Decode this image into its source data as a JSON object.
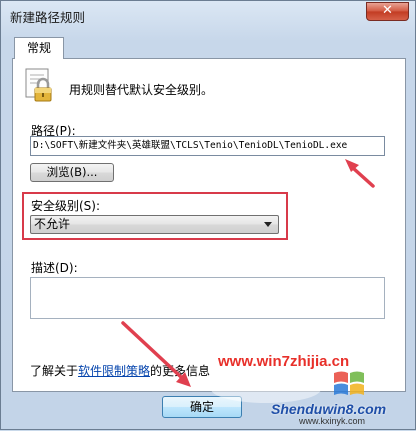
{
  "window": {
    "title": "新建路径规则",
    "close_label": "✕"
  },
  "tabs": [
    {
      "label": "常规"
    }
  ],
  "general": {
    "description": "用规则替代默认安全级别。",
    "path_label": "路径(P):",
    "path_value": "D:\\SOFT\\新建文件夹\\英雄联盟\\TCLS\\Tenio\\TenioDL\\TenioDL.exe",
    "browse_label": "浏览(B)...",
    "security_level_label": "安全级别(S):",
    "security_level_value": "不允许",
    "description_label": "描述(D):",
    "description_value": "",
    "learn_more_prefix": "了解关于",
    "learn_more_link": "软件限制策略",
    "learn_more_suffix": "的更多信息"
  },
  "buttons": {
    "ok": "确定"
  },
  "watermarks": {
    "site_top": "www.win7zhijia.cn",
    "site_bottom": "Shenduwin8.com",
    "site_sub": "www.kxinyk.com"
  },
  "colors": {
    "highlight": "#d83a4a",
    "arrow": "#e0404f",
    "link": "#0645ad"
  },
  "icons": {
    "lock": "lock-icon",
    "close": "close-icon",
    "dropdown": "chevron-down-icon"
  }
}
